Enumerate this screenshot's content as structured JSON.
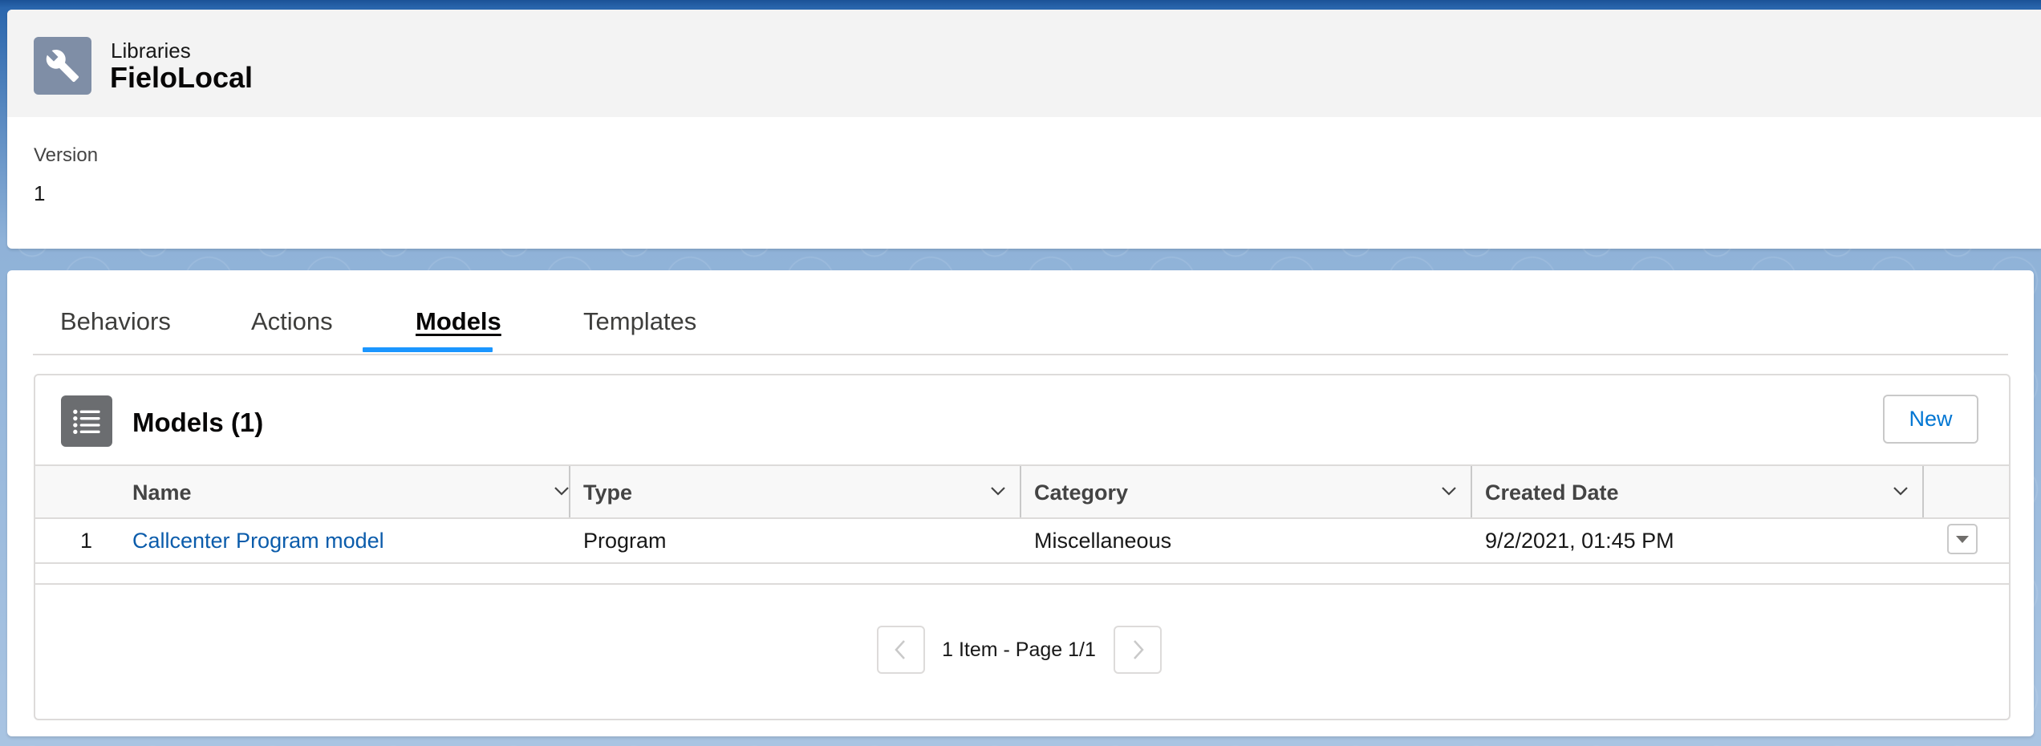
{
  "header": {
    "object_label": "Libraries",
    "record_title": "FieloLocal",
    "icon": "wrench-icon",
    "icon_color": "#7f8ea6"
  },
  "details": {
    "version_label": "Version",
    "version_value": "1"
  },
  "tabs": [
    {
      "label": "Behaviors",
      "active": false
    },
    {
      "label": "Actions",
      "active": false
    },
    {
      "label": "Models",
      "active": true
    },
    {
      "label": "Templates",
      "active": false
    }
  ],
  "related_list": {
    "title": "Models (1)",
    "icon": "list-icon",
    "new_button_label": "New",
    "columns": [
      "Name",
      "Type",
      "Category",
      "Created Date"
    ],
    "rows": [
      {
        "index": "1",
        "name": "Callcenter Program model",
        "type": "Program",
        "category": "Miscellaneous",
        "created_date": "9/2/2021, 01:45 PM"
      }
    ]
  },
  "pagination": {
    "text": "1 Item - Page 1/1"
  },
  "colors": {
    "link": "#0b5cab",
    "active_tab_indicator": "#1b96ff",
    "button_text": "#0176d3"
  }
}
